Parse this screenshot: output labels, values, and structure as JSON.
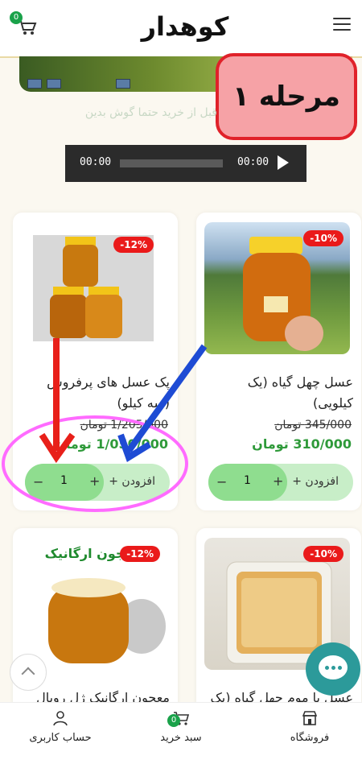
{
  "header": {
    "logo": "کوهدار",
    "cart_count": "0"
  },
  "banner": {
    "text": ""
  },
  "stage_badge": "مرحله ۱",
  "subtitle": "قبل از خرید حتما گوش بدین",
  "audio": {
    "current_time": "00:00",
    "duration": "00:00"
  },
  "products": [
    {
      "title": "عسل چهل گیاه (یک کیلویی)",
      "discount": "-10%",
      "old_price": "345/000 تومان",
      "new_price": "310/000 تومان",
      "qty": "1",
      "add_label": "افزودن +"
    },
    {
      "title": "پک عسل های پرفروش (سه کیلو)",
      "discount": "-12%",
      "old_price": "1/205/000 تومان",
      "new_price": "1/050/000 تومان",
      "qty": "1",
      "add_label": "افزودن +"
    },
    {
      "title": "عسل با موم چهل گیاه (یک",
      "discount": "-10%"
    },
    {
      "title": "معجون ارگانیک ژل رویال",
      "discount": "-12%",
      "image_caption": "معجون ارگانیک"
    }
  ],
  "colors": {
    "accent": "#2f9a3a",
    "discount": "#ea1a1a",
    "stepper_light": "#c8eec8",
    "stepper_dark": "#8fdd8f"
  },
  "bottom_nav": {
    "shop": "فروشگاه",
    "cart": "سبد خرید",
    "cart_count": "0",
    "account": "حساب کاربری"
  }
}
